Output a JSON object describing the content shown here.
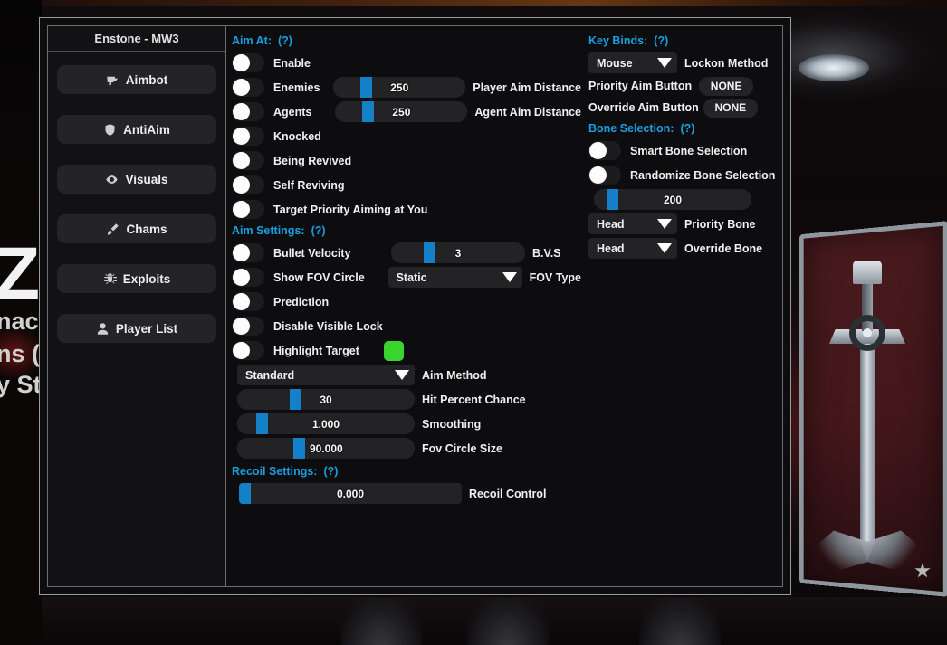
{
  "background": {
    "left_overlay": {
      "big_letter": "Z",
      "line1": "nacc",
      "line2": "ns (",
      "line3": "y St"
    },
    "accent_blue": "#1a9fe0",
    "highlight_green": "#3ad42f"
  },
  "window": {
    "title": "Enstone - MW3"
  },
  "sidebar": {
    "items": [
      {
        "label": "Aimbot",
        "icon": "pistol-icon"
      },
      {
        "label": "AntiAim",
        "icon": "shield-icon"
      },
      {
        "label": "Visuals",
        "icon": "eye-icon"
      },
      {
        "label": "Chams",
        "icon": "paintbrush-icon"
      },
      {
        "label": "Exploits",
        "icon": "bug-icon"
      },
      {
        "label": "Player List",
        "icon": "person-icon"
      }
    ]
  },
  "aim_at": {
    "header": "Aim At:",
    "help": "(?)",
    "toggles": [
      {
        "label": "Enable",
        "on": false
      },
      {
        "label": "Enemies",
        "on": false
      },
      {
        "label": "Agents",
        "on": false
      },
      {
        "label": "Knocked",
        "on": false
      },
      {
        "label": "Being Revived",
        "on": false
      },
      {
        "label": "Self Reviving",
        "on": false
      },
      {
        "label": "Target Priority Aiming at You",
        "on": false
      }
    ],
    "player_aim_distance": {
      "value": "250",
      "label": "Player Aim Distance",
      "fill_pct": 22
    },
    "agent_aim_distance": {
      "value": "250",
      "label": "Agent Aim Distance",
      "fill_pct": 22
    }
  },
  "aim_settings": {
    "header": "Aim Settings:",
    "help": "(?)",
    "bullet_velocity": {
      "toggle_label": "Bullet Velocity",
      "on": false,
      "value": "3",
      "slider_label": "B.V.S",
      "fill_pct": 24
    },
    "show_fov_circle": {
      "toggle_label": "Show FOV Circle",
      "on": false,
      "dropdown_value": "Static",
      "dropdown_label": "FOV Type"
    },
    "prediction": {
      "toggle_label": "Prediction",
      "on": false
    },
    "disable_visible_lock": {
      "toggle_label": "Disable Visible Lock",
      "on": false
    },
    "highlight_target": {
      "toggle_label": "Highlight Target",
      "on": false,
      "color": "#3ad42f"
    },
    "aim_method": {
      "value": "Standard",
      "label": "Aim Method"
    },
    "hit_percent_chance": {
      "value": "30",
      "label": "Hit Percent Chance",
      "fill_pct": 32
    },
    "smoothing": {
      "value": "1.000",
      "label": "Smoothing",
      "fill_pct": 12
    },
    "fov_circle_size": {
      "value": "90.000",
      "label": "Fov Circle Size",
      "fill_pct": 31
    }
  },
  "recoil_settings": {
    "header": "Recoil Settings:",
    "help": "(?)",
    "recoil_control": {
      "value": "0.000",
      "label": "Recoil Control",
      "fill_pct": 1
    }
  },
  "key_binds": {
    "header": "Key Binds:",
    "help": "(?)",
    "lockon_method": {
      "value": "Mouse",
      "label": "Lockon Method"
    },
    "priority_aim_button": {
      "label": "Priority Aim Button",
      "value": "NONE"
    },
    "override_aim_button": {
      "label": "Override Aim Button",
      "value": "NONE"
    }
  },
  "bone_selection": {
    "header": "Bone Selection:",
    "help": "(?)",
    "smart_bone_selection": {
      "label": "Smart Bone Selection",
      "on": false
    },
    "randomize_bone_selection": {
      "label": "Randomize Bone Selection",
      "on": false
    },
    "randomize_slider": {
      "value": "200",
      "fill_pct": 8
    },
    "priority_bone": {
      "value": "Head",
      "label": "Priority Bone"
    },
    "override_bone": {
      "value": "Head",
      "label": "Override Bone"
    }
  }
}
